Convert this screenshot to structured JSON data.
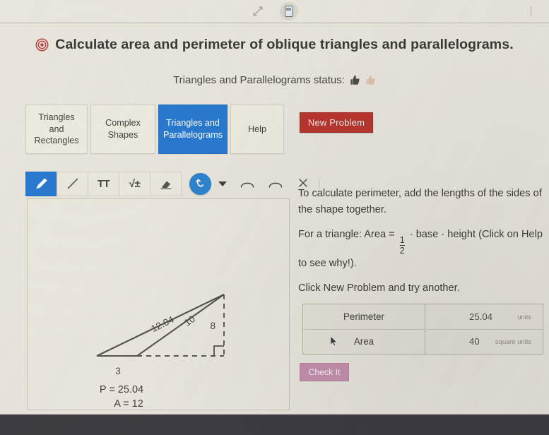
{
  "topbar": {
    "expand_icon": "expand-arrows-icon",
    "calculator_icon": "calculator-icon"
  },
  "header": {
    "target_icon": "target-icon",
    "title": "Calculate area and perimeter of oblique triangles and parallelograms.",
    "status_label": "Triangles and Parallelograms status:",
    "status_icons": [
      "thumbs-up-filled-icon",
      "thumbs-up-outline-icon"
    ]
  },
  "tabs": [
    {
      "label": "Triangles and Rectangles",
      "active": false
    },
    {
      "label": "Complex Shapes",
      "active": false
    },
    {
      "label": "Triangles and Parallelograms",
      "active": true
    },
    {
      "label": "Help",
      "active": false
    }
  ],
  "actions": {
    "new_problem": "New Problem",
    "check_it": "Check It"
  },
  "toolbar": {
    "tools": [
      {
        "name": "pencil-icon",
        "label": "",
        "active": true
      },
      {
        "name": "line-icon",
        "label": "",
        "active": false
      },
      {
        "name": "text-tool-icon",
        "label": "TT",
        "active": false
      },
      {
        "name": "square-root-icon",
        "label": "√±",
        "active": false
      },
      {
        "name": "eraser-icon",
        "label": "",
        "active": false
      }
    ],
    "undo_icon": "undo-curve-icon",
    "dropdown_icon": "chevron-down-icon",
    "arc_icon_1": "arc-icon",
    "arc_icon_2": "arc-icon",
    "close_icon": "close-x-icon"
  },
  "canvas": {
    "shape": "oblique-triangle",
    "labels": {
      "hypotenuse": "12.04",
      "slant_side": "10",
      "height": "8",
      "base": "3"
    },
    "results": {
      "perimeter": "P = 25.04",
      "area": "A = 12"
    }
  },
  "instructions": {
    "p1": "To calculate perimeter, add the lengths of the sides of the shape together.",
    "p2_a": "For a triangle: Area =",
    "frac_num": "1",
    "frac_den": "2",
    "p2_b": "· base ·  height (Click on Help to see why!).",
    "p3": "Click New Problem and try another."
  },
  "answer_table": {
    "rows": [
      {
        "label": "Perimeter",
        "value": "25.04",
        "unit": "units"
      },
      {
        "label": "Area",
        "value": "40",
        "unit": "square units"
      }
    ],
    "cursor_icon": "mouse-pointer-icon"
  },
  "colors": {
    "accent_blue": "#2979cf",
    "new_problem_red": "#b8362f",
    "check_it_pink": "#c590ad",
    "page_bg": "#e8e5dc",
    "bottom_bar": "#3c3c42"
  }
}
